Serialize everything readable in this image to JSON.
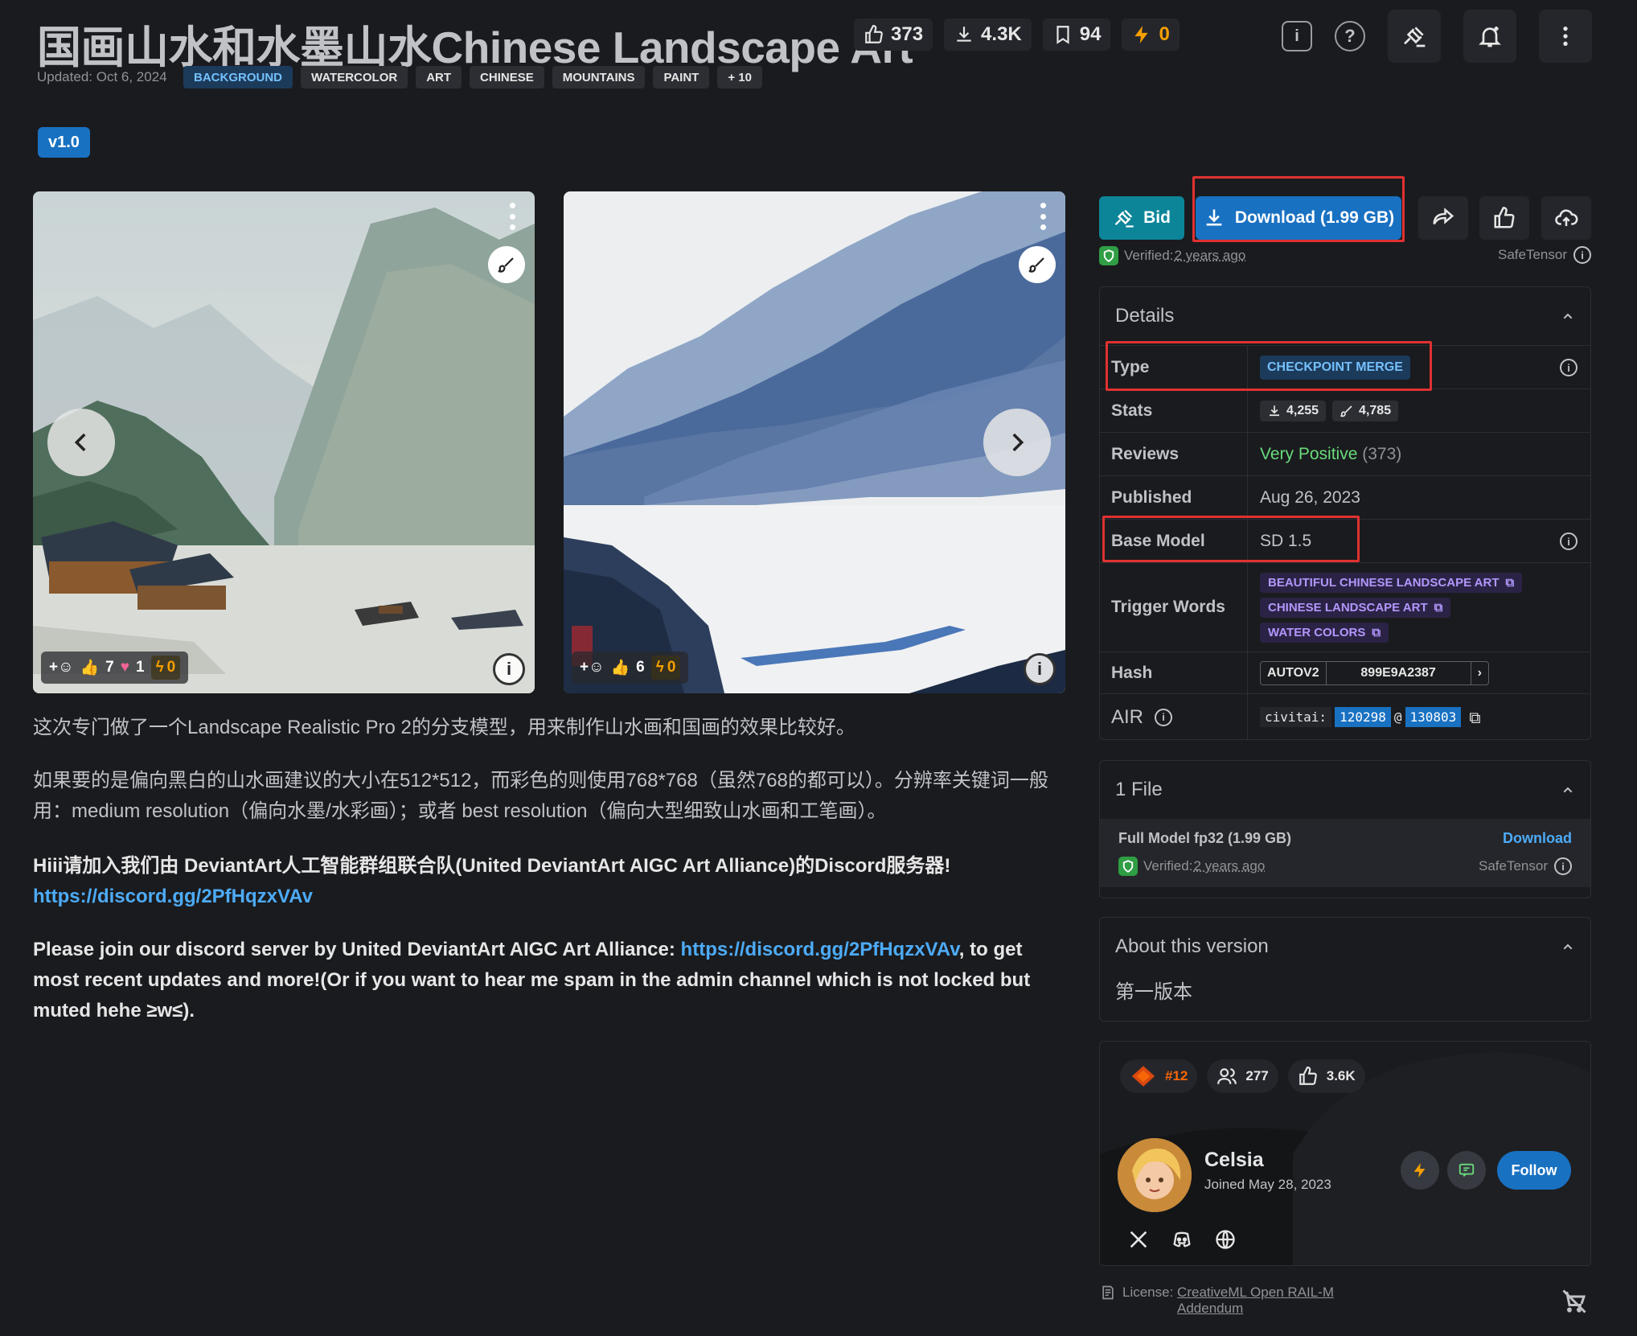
{
  "header": {
    "title": "国画山水和水墨山水Chinese Landscape Art",
    "likes": "373",
    "downloads": "4.3K",
    "bookmarks": "94",
    "buzz": "0",
    "updated": "Updated: Oct 6, 2024",
    "tags": [
      "BACKGROUND",
      "WATERCOLOR",
      "ART",
      "CHINESE",
      "MOUNTAINS",
      "PAINT",
      "+ 10"
    ]
  },
  "version": "v1.0",
  "gallery": {
    "images": [
      {
        "reaction_likes": "7",
        "reaction_hearts": "1",
        "reaction_buzz": "0"
      },
      {
        "reaction_likes": "6",
        "reaction_buzz": "0"
      }
    ]
  },
  "description": {
    "p1": "这次专门做了一个Landscape Realistic Pro 2的分支模型，用来制作山水画和国画的效果比较好。",
    "p2a": "如果要的是偏向黑白的山水画建议的大小在512*512，而彩色的则使用768*768（虽然768的都可以）。分辨率关键词一般",
    "p2b": "用：medium resolution（偏向水墨/水彩画）；或者 best resolution（偏向大型细致山水画和工笔画）。",
    "p3": "Hiii请加入我们由 DeviantArt人工智能群组联合队(United DeviantArt AIGC Art Alliance)的Discord服务器!",
    "p3_link": "https://discord.gg/2PfHqzxVAv",
    "p4a": "Please join our discord server by United DeviantArt AIGC Art Alliance: ",
    "p4_link": "https://discord.gg/2PfHqzxVAv",
    "p4b": ", to get",
    "p4c": "most recent updates and more!(Or if you want to hear me spam in the admin channel which is not locked but",
    "p4d": "muted hehe ≥w≤)."
  },
  "actions": {
    "bid": "Bid",
    "download": "Download (1.99 GB)",
    "verified_prefix": "Verified: ",
    "verified_time": "2 years ago",
    "safetensor": "SafeTensor"
  },
  "details": {
    "heading": "Details",
    "type_label": "Type",
    "type_value": "CHECKPOINT MERGE",
    "stats_label": "Stats",
    "stats_downloads": "4,255",
    "stats_generations": "4,785",
    "reviews_label": "Reviews",
    "reviews_value": "Very Positive",
    "reviews_count": "(373)",
    "published_label": "Published",
    "published_value": "Aug 26, 2023",
    "base_label": "Base Model",
    "base_value": "SD 1.5",
    "trigger_label": "Trigger Words",
    "triggers": [
      "BEAUTIFUL CHINESE LANDSCAPE ART",
      "CHINESE LANDSCAPE ART",
      "WATER COLORS"
    ],
    "hash_label": "Hash",
    "hash_type": "AUTOV2",
    "hash_value": "899E9A2387",
    "air_label": "AIR",
    "air_prefix": "civitai:",
    "air_model": "120298",
    "air_at": "@",
    "air_version": "130803"
  },
  "files": {
    "heading": "1 File",
    "name": "Full Model fp32 (1.99 GB)",
    "download": "Download",
    "verified_prefix": "Verified: ",
    "verified_time": "2 years ago",
    "safetensor": "SafeTensor"
  },
  "about": {
    "heading": "About this version",
    "text": "第一版本"
  },
  "creator": {
    "rank": "#12",
    "followers": "277",
    "likes": "3.6K",
    "name": "Celsia",
    "joined": "Joined May 28, 2023",
    "follow": "Follow"
  },
  "license": {
    "prefix": "License: ",
    "link1": "CreativeML Open RAIL-M",
    "link2": "Addendum"
  },
  "colors": {
    "background": "#1a1b1e",
    "accent_blue": "#1971c2",
    "bid_teal": "#0c8599",
    "positive_green": "#69db7c",
    "buzz_orange": "#f59f00",
    "highlight_red": "#e03131"
  }
}
